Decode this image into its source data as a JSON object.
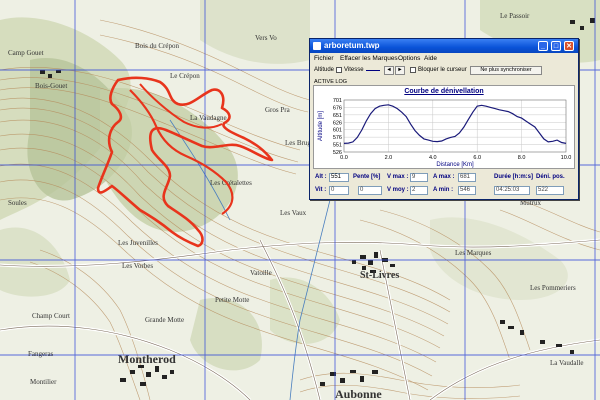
{
  "map": {
    "labels": {
      "bois_crepon": "Bois du Crépon",
      "sur_crepon": "Le Crépon",
      "vaux_gouet": "Bois-Gouet",
      "la_vaudagne": "La Vaudagne",
      "gros_pra": "Gros Pra",
      "les_brugeres": "Les Brugères",
      "les_cretalettes": "Les Crétalettes",
      "les_vaux": "Les Vaux",
      "les_juvenilles": "Les Juvenilles",
      "les_vorbes": "Les Vorbes",
      "st_livres": "St-Livres",
      "la_ronde": "Vatoille",
      "petite_motte": "Petite Motte",
      "grande_motte": "Grande Motte",
      "champ_court": "Champ Court",
      "montherod": "Montherod",
      "aubonne": "Aubonne",
      "le_passoir": "Le Passoir",
      "les_pommeriers": "Les Pommeriers",
      "la_vaudalle": "La Vaudalle",
      "mutrux": "Mutrux",
      "les_marques": "Les Marques",
      "sur_saule": "Soules",
      "sur_vo": "Vers Vo",
      "fangeras": "Fangeras",
      "montilier": "Montilier",
      "camp_gouet": "Camp Gouet"
    }
  },
  "window": {
    "title": "arboretum.twp",
    "min_glyph": "_",
    "max_glyph": "□",
    "close_glyph": "✕",
    "menu": [
      "Fichier",
      "Effacer les Marques",
      "Options",
      "Aide"
    ],
    "toolbar": {
      "altitude_label": "Altitude",
      "vitesse_label": "Vitesse",
      "prev_glyph": "◄",
      "next_glyph": "►",
      "bloquer_label": "Bloquer le curseur",
      "sync_label": "Ne plus synchroniser"
    },
    "tab_label": "ACTIVE LOG",
    "status": {
      "alt_label": "Alt :",
      "alt_value": "551",
      "pente_label": "Pente [%]",
      "pente_value": "0",
      "vmax_label": "V max :",
      "vmax_value": "9",
      "amax_label": "A max :",
      "amax_value": "681",
      "duree_label": "Durée [h:m:s]",
      "duree_value": "04:25:03",
      "deniv_label": "Déni. pos.",
      "deniv_value": "522",
      "vit_label": "Vit :",
      "vit_value": "0",
      "vit2_value": "0",
      "vmoy_label": "V moy :",
      "vmoy_value": "2",
      "amin_label": "A min :",
      "amin_value": "546",
      "duree2_value": "04:25:03",
      "deniv2_value": "522"
    }
  },
  "chart_data": {
    "type": "line",
    "title": "Courbe de dénivellation",
    "xlabel": "Distance [Km]",
    "ylabel": "Altitude [m]",
    "xlim": [
      0,
      10
    ],
    "ylim": [
      526,
      701
    ],
    "xticks": [
      "0.0",
      "2.0",
      "4.0",
      "6.0",
      "8.0",
      "10.0"
    ],
    "yticks": [
      "526",
      "551",
      "576",
      "601",
      "626",
      "651",
      "676",
      "701"
    ],
    "grid": true,
    "series": [
      {
        "color": "#1a1a7a",
        "x": [
          0.0,
          0.2,
          0.4,
          0.6,
          0.8,
          1.0,
          1.2,
          1.4,
          1.6,
          1.8,
          2.0,
          2.2,
          2.4,
          2.6,
          2.8,
          3.0,
          3.2,
          3.4,
          3.6,
          3.8,
          4.0,
          4.2,
          4.4,
          4.6,
          4.8,
          5.0,
          5.2,
          5.4,
          5.6,
          5.8,
          6.0,
          6.2,
          6.4,
          6.6,
          6.8,
          7.0,
          7.2,
          7.4,
          7.6,
          7.8,
          8.0,
          8.2,
          8.4,
          8.6,
          8.8,
          9.0,
          9.2,
          9.4,
          9.6,
          9.8,
          10.0
        ],
        "y": [
          555,
          556,
          560,
          575,
          600,
          630,
          655,
          672,
          680,
          683,
          685,
          680,
          672,
          660,
          645,
          620,
          598,
          582,
          570,
          566,
          562,
          561,
          563,
          570,
          575,
          578,
          590,
          610,
          635,
          660,
          680,
          683,
          680,
          676,
          672,
          668,
          665,
          662,
          655,
          645,
          640,
          630,
          620,
          610,
          590,
          570,
          560,
          562,
          566,
          558,
          555
        ]
      }
    ]
  }
}
